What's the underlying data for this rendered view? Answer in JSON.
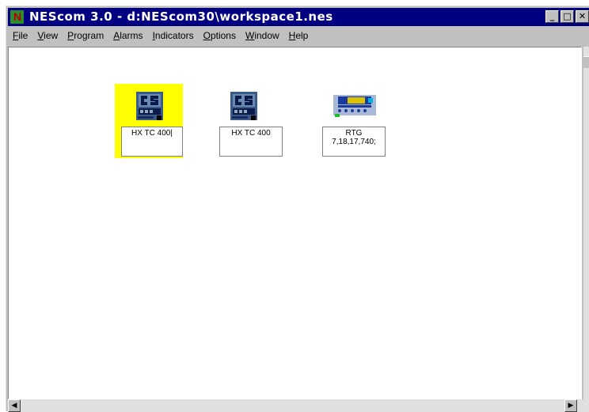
{
  "window": {
    "title": "NEScom 3.0 - d:NEScom30\\workspace1.nes",
    "app_icon": "N",
    "buttons": {
      "minimize": "_",
      "maximize": "□",
      "close": "✕"
    }
  },
  "menu": {
    "items": [
      "File",
      "View",
      "Program",
      "Alarms",
      "Indicators",
      "Options",
      "Window",
      "Help"
    ]
  },
  "devices": [
    {
      "label": "HX TC 400|",
      "icon": "hx-tc-400-icon",
      "selected": true
    },
    {
      "label": "HX TC 400",
      "icon": "hx-tc-400-icon",
      "selected": false
    },
    {
      "label_line1": "RTG",
      "label_line2": "7,18,17,740;",
      "icon": "rtg-device-icon",
      "selected": false
    }
  ],
  "scrollbar": {
    "left_arrow": "◀",
    "right_arrow": "▶",
    "up_arrow": "▲"
  },
  "colors": {
    "title_bg": "#000080",
    "selection": "#ffff00",
    "window_bg": "#c0c0c0"
  }
}
